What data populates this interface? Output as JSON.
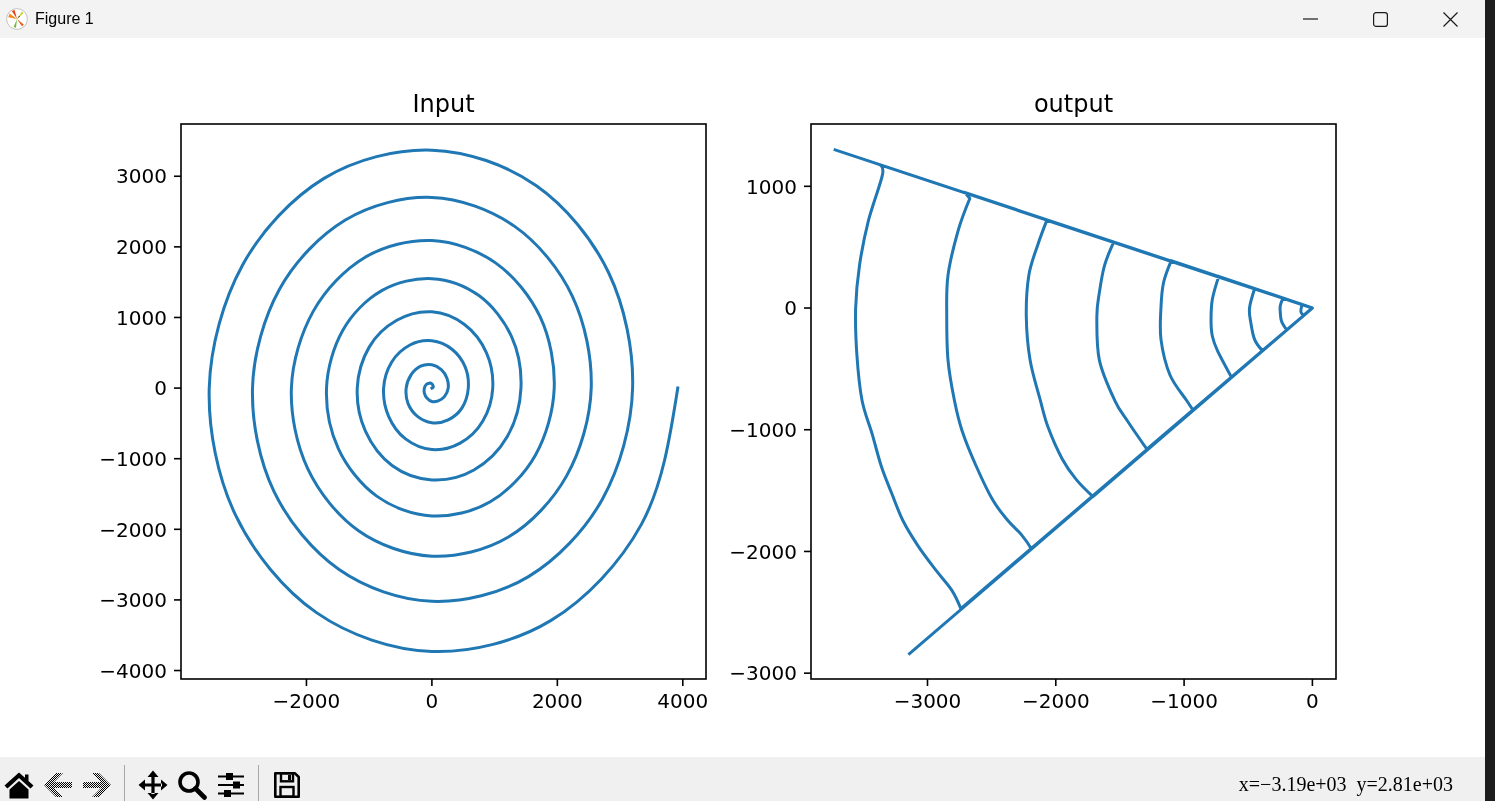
{
  "window": {
    "title": "Figure 1",
    "controls": [
      {
        "kind": "minimize"
      },
      {
        "kind": "maximize"
      },
      {
        "kind": "close"
      }
    ]
  },
  "figure": {
    "chart_data": [
      {
        "type": "line",
        "title": "Input",
        "color": "#1f77b4",
        "xlim": [
          -4000,
          4370
        ],
        "ylim": [
          -4120,
          3740
        ],
        "xticks": [
          {
            "value": -2000,
            "label": "−2000"
          },
          0,
          2000,
          4000
        ],
        "yticks": [
          {
            "value": -4000,
            "label": "−4000"
          },
          {
            "value": -3000,
            "label": "−3000"
          },
          {
            "value": -2000,
            "label": "−2000"
          },
          {
            "value": -1000,
            "label": "−1000"
          },
          0,
          1000,
          2000,
          3000
        ],
        "x": [
          0,
          20,
          20,
          0,
          -40,
          -90,
          -120,
          -120,
          -80,
          0,
          100,
          200,
          260,
          240,
          150,
          0,
          -180,
          -330,
          -410,
          -380,
          -230,
          0,
          260,
          480,
          580,
          530,
          320,
          0,
          -350,
          -640,
          -770,
          -690,
          -420,
          0,
          450,
          810,
          970,
          870,
          520,
          0,
          -560,
          -1000,
          -1190,
          -1060,
          -630,
          0,
          670,
          1200,
          1420,
          1270,
          750,
          0,
          -800,
          -1420,
          -1680,
          -1490,
          -880,
          0,
          930,
          1650,
          1950,
          1730,
          1020,
          0,
          -1070,
          -1890,
          -2240,
          -1980,
          -1170,
          0,
          1220,
          2150,
          2540,
          2240,
          1320,
          0,
          -1380,
          -2430,
          -2860,
          -2520,
          -1480,
          0,
          1540,
          2720,
          3200,
          2820,
          1660,
          0,
          -1720,
          -3020,
          -3550,
          -3130,
          -1840,
          0,
          1900,
          3340,
          3920
        ],
        "values": [
          0,
          10,
          30,
          60,
          70,
          50,
          0,
          -70,
          -140,
          -190,
          -180,
          -120,
          0,
          140,
          260,
          330,
          310,
          190,
          0,
          -220,
          -400,
          -490,
          -450,
          -280,
          0,
          300,
          550,
          670,
          610,
          370,
          0,
          -400,
          -720,
          -870,
          -780,
          -470,
          0,
          500,
          900,
          1080,
          960,
          580,
          0,
          -610,
          -1100,
          -1300,
          -1160,
          -690,
          0,
          730,
          1310,
          1550,
          1380,
          820,
          0,
          -860,
          -1530,
          -1810,
          -1610,
          -950,
          0,
          1000,
          1770,
          2090,
          1850,
          1090,
          0,
          -1140,
          -2020,
          -2380,
          -2110,
          -1240,
          0,
          1300,
          2290,
          2700,
          2380,
          1400,
          0,
          -1460,
          -2570,
          -3020,
          -2670,
          -1570,
          0,
          1630,
          2870,
          3370,
          2970,
          1740,
          0,
          -1800,
          -3180,
          -3730,
          -3290,
          -1930,
          0
        ]
      },
      {
        "type": "line",
        "title": "output",
        "color": "#1f77b4",
        "xlim": [
          -3908,
          184
        ],
        "ylim": [
          -3048,
          1512
        ],
        "xticks": [
          {
            "value": -3000,
            "label": "−3000"
          },
          {
            "value": -2000,
            "label": "−2000"
          },
          {
            "value": -1000,
            "label": "−1000"
          },
          0
        ],
        "yticks": [
          {
            "value": -3000,
            "label": "−3000"
          },
          {
            "value": -2000,
            "label": "−2000"
          },
          {
            "value": -1000,
            "label": "−1000"
          },
          0,
          1000
        ],
        "x": [
          -3720,
          0,
          -80,
          -90,
          -70,
          0,
          -230,
          -250,
          -250,
          -240,
          -200,
          0,
          -450,
          -490,
          -480,
          -450,
          -390,
          0,
          -730,
          -780,
          -790,
          -780,
          -740,
          -630,
          0,
          -1100,
          -1160,
          -1180,
          -1180,
          -1110,
          -980,
          -930,
          0,
          -1550,
          -1620,
          -1660,
          -1680,
          -1660,
          -1540,
          -1440,
          -1290,
          0,
          -2070,
          -2140,
          -2210,
          -2230,
          -2200,
          -2120,
          -2060,
          -1950,
          -1840,
          -1710,
          0,
          -2710,
          -2670,
          -2760,
          -2840,
          -2850,
          -2840,
          -2790,
          -2730,
          -2620,
          -2490,
          -2370,
          -2270,
          -2190,
          0,
          -3380,
          -3350,
          -3460,
          -3530,
          -3560,
          -3550,
          -3510,
          -3430,
          -3360,
          -3280,
          -3190,
          -3070,
          -2930,
          -2810,
          -2740,
          0,
          -3140
        ],
        "values": [
          1300,
          0,
          30,
          -30,
          -60,
          0,
          80,
          20,
          -40,
          -110,
          -180,
          0,
          160,
          0,
          -120,
          -260,
          -350,
          0,
          260,
          70,
          -100,
          -230,
          -350,
          -570,
          0,
          390,
          210,
          10,
          -260,
          -550,
          -760,
          -840,
          0,
          540,
          350,
          130,
          -70,
          -430,
          -760,
          -930,
          -1160,
          0,
          720,
          520,
          270,
          -70,
          -430,
          -760,
          -980,
          -1240,
          -1410,
          -1550,
          0,
          950,
          900,
          640,
          270,
          -70,
          -430,
          -760,
          -1010,
          -1300,
          -1580,
          -1750,
          -1860,
          -1980,
          0,
          1180,
          1100,
          720,
          350,
          0,
          -390,
          -760,
          -1040,
          -1300,
          -1520,
          -1750,
          -1960,
          -2160,
          -2320,
          -2470,
          0,
          -2840
        ]
      }
    ]
  },
  "toolbar": {
    "items": [
      {
        "kind": "home",
        "disabled": false
      },
      {
        "kind": "back",
        "disabled": true
      },
      {
        "kind": "forward",
        "disabled": true
      },
      {
        "kind": "separator"
      },
      {
        "kind": "pan",
        "disabled": false
      },
      {
        "kind": "zoom",
        "disabled": false
      },
      {
        "kind": "configure",
        "disabled": false
      },
      {
        "kind": "separator"
      },
      {
        "kind": "save",
        "disabled": false
      }
    ],
    "coordinates": "x=−3.19e+03  y=2.81e+03"
  }
}
